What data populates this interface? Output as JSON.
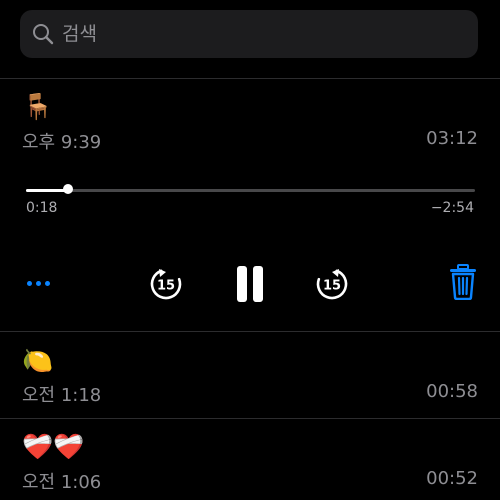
{
  "search": {
    "placeholder": "검색"
  },
  "recordings": [
    {
      "emoji": "🪑",
      "time": "오후 9:39",
      "duration": "03:12"
    },
    {
      "emoji": "🍋",
      "time": "오전 1:18",
      "duration": "00:58"
    },
    {
      "emoji": "❤️‍🩹❤️‍🩹",
      "time": "오전 1:06",
      "duration": "00:52"
    }
  ],
  "player": {
    "elapsed": "0:18",
    "remaining": "−2:54",
    "progress": 0.094,
    "skip_back_seconds": "15",
    "skip_forward_seconds": "15"
  },
  "colors": {
    "accent": "#0a84ff",
    "background": "#000000",
    "secondary_text": "#8e8e93"
  },
  "icons": [
    "search-icon",
    "more-icon",
    "skip-back-15-icon",
    "pause-icon",
    "skip-forward-15-icon",
    "trash-icon"
  ]
}
